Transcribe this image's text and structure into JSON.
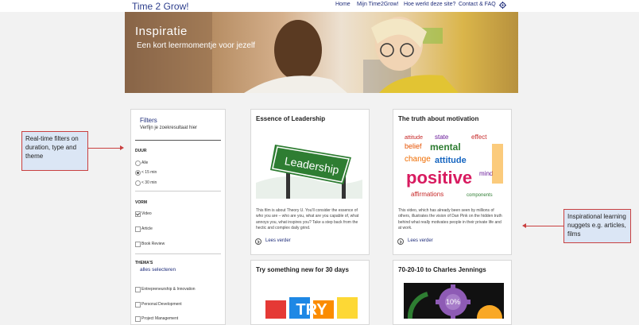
{
  "header": {
    "logo": "Time 2 Grow!",
    "nav": [
      "Home",
      "Mijn Time2Grow!",
      "Hoe werkt deze site?",
      "Contact & FAQ"
    ]
  },
  "hero": {
    "title": "Inspiratie",
    "subtitle": "Een kort leermomentje voor jezelf"
  },
  "filters": {
    "title": "Filters",
    "subtitle": "Verfijn je zoekresultaat hier",
    "duration": {
      "heading": "DUUR",
      "options": [
        "Alle",
        "< 15 min",
        "< 30 min"
      ],
      "selected": "< 15 min"
    },
    "form": {
      "heading": "VORM",
      "options": [
        "Video",
        "Article",
        "Book Review"
      ],
      "checked": [
        "Video"
      ]
    },
    "themes": {
      "heading": "THEMA'S",
      "select_all": "alles selecteren",
      "options": [
        "Entrepreneurship & Innovation",
        "Personal Development",
        "Project Management"
      ]
    }
  },
  "cards": [
    {
      "title": "Essence of Leadership",
      "image_label": "Leadership",
      "description": "This film is about Theory U. You'll consider the essence of who you are – who are you, what are you capable of, what annoys you, what inspires you? Take a step back from the hectic and complex daily grind.",
      "more": "Lees verder"
    },
    {
      "title": "The truth about motivation",
      "image_words": [
        "positive",
        "mental",
        "attitude",
        "change",
        "affirmations",
        "effect"
      ],
      "description": "This video, which has already been seen by millions of others, illustrates the vision of Dan Pink on the hidden truth behind what really motivates people in their private life and at work.",
      "more": "Lees verder"
    },
    {
      "title": "Try something new for 30 days",
      "image_label": "TRY"
    },
    {
      "title": "70-20-10 to Charles Jennings",
      "image_label": "10%"
    }
  ],
  "annotations": {
    "left": "Real-time filters on duration, type and theme",
    "right": "Inspirational learning nuggets e.g. articles, films"
  },
  "colors": {
    "nav_blue": "#1f2d7a",
    "callout_border": "#c94040",
    "callout_fill": "#dbe6f5"
  }
}
